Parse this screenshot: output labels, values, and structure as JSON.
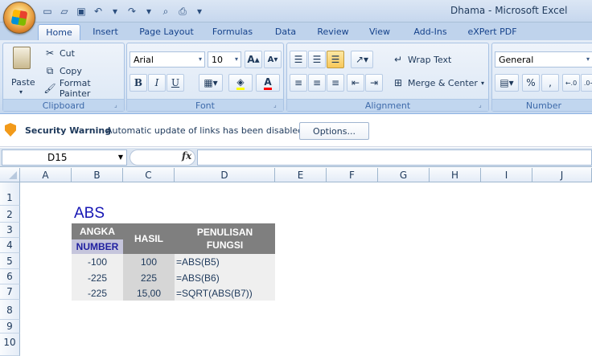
{
  "window": {
    "title": "Dhama - Microsoft Excel"
  },
  "ribbon": {
    "tabs": [
      "Home",
      "Insert",
      "Page Layout",
      "Formulas",
      "Data",
      "Review",
      "View",
      "Add-Ins",
      "eXPert PDF"
    ],
    "clipboard": {
      "label": "Clipboard",
      "paste": "Paste",
      "cut": "Cut",
      "copy": "Copy",
      "format_painter": "Format Painter"
    },
    "font": {
      "label": "Font",
      "name": "Arial",
      "size": "10"
    },
    "alignment": {
      "label": "Alignment",
      "wrap_text": "Wrap Text",
      "merge_center": "Merge & Center"
    },
    "number": {
      "label": "Number",
      "format": "General"
    }
  },
  "security_bar": {
    "title": "Security Warning",
    "message": "Automatic update of links has been disabled",
    "options_button": "Options..."
  },
  "formula_bar": {
    "name_box": "D15",
    "formula": ""
  },
  "sheet": {
    "columns": [
      "A",
      "B",
      "C",
      "D",
      "E",
      "F",
      "G",
      "H",
      "I",
      "J"
    ],
    "rows": [
      "1",
      "2",
      "3",
      "4",
      "5",
      "6",
      "7",
      "8",
      "9",
      "10"
    ],
    "title": "ABS",
    "headers": {
      "angka": "ANGKA",
      "number": "NUMBER",
      "hasil": "HASIL",
      "penulisan": "PENULISAN",
      "fungsi": "FUNGSI"
    },
    "data": [
      {
        "angka": "-100",
        "hasil": "100",
        "formula": "=ABS(B5)"
      },
      {
        "angka": "-225",
        "hasil": "225",
        "formula": "=ABS(B6)"
      },
      {
        "angka": "-225",
        "hasil": "15,00",
        "formula": "=SQRT(ABS(B7))"
      }
    ]
  },
  "colors": {
    "header_gray": "#7f7f7f",
    "number_band": "#c5c5dc",
    "number_text": "#1f1fa0",
    "data_light": "#efefef",
    "data_mid": "#d6d6d6",
    "title_blue": "#1515b4"
  }
}
